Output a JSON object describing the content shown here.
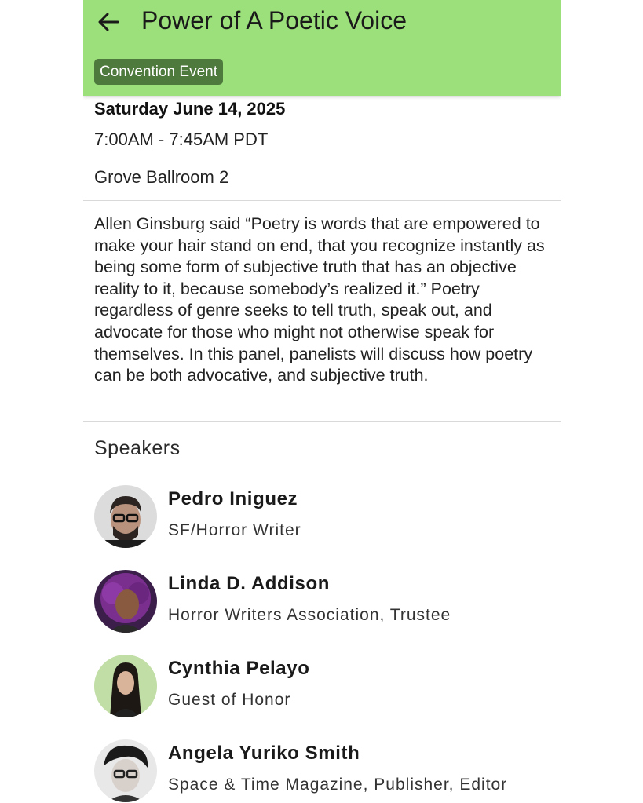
{
  "header": {
    "title": "Power of A Poetic Voice",
    "back_icon": "arrow-left-icon",
    "category_chip": "Convention Event",
    "background_color": "#9be07a",
    "chip_color": "#4f7a3e"
  },
  "event": {
    "date": "Saturday June 14, 2025",
    "time": "7:00AM - 7:45AM PDT",
    "location": "Grove Ballroom 2",
    "description": "Allen Ginsburg said “Poetry is words that are empowered to make your hair stand on end, that you recognize instantly as being some form of subjective truth that has an objective reality to it, because somebody’s realized it.” Poetry regardless of genre seeks to tell truth, speak out, and advocate for those who might not otherwise speak for themselves. In this panel, panelists will discuss how poetry can be both advocative, and subjective truth."
  },
  "speakers": {
    "heading": "Speakers",
    "items": [
      {
        "name": "Pedro Iniguez",
        "role": "SF/Horror Writer"
      },
      {
        "name": "Linda D. Addison",
        "role": "Horror Writers Association, Trustee"
      },
      {
        "name": "Cynthia Pelayo",
        "role": "Guest of Honor"
      },
      {
        "name": "Angela Yuriko Smith",
        "role": "Space & Time Magazine, Publisher, Editor"
      }
    ]
  }
}
